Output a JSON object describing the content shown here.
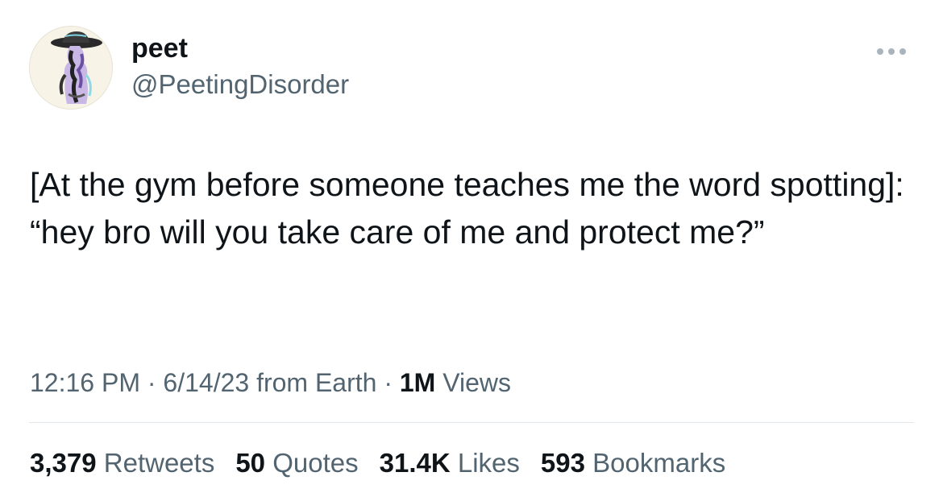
{
  "author": {
    "display_name": "peet",
    "handle": "@PeetingDisorder"
  },
  "tweet": {
    "text": "[At the gym before someone teaches me the word spotting]: “hey bro will you take care of me and protect me?”"
  },
  "meta": {
    "time": "12:16 PM",
    "sep1": " · ",
    "date": "6/14/23",
    "source": " from Earth",
    "sep2": " · ",
    "views_count": "1M",
    "views_label": " Views"
  },
  "stats": [
    {
      "count": "3,379",
      "label": "Retweets"
    },
    {
      "count": "50",
      "label": "Quotes"
    },
    {
      "count": "31.4K",
      "label": "Likes"
    },
    {
      "count": "593",
      "label": "Bookmarks"
    }
  ],
  "icons": {
    "more": "more-horizontal-icon"
  },
  "colors": {
    "text_primary": "#0f1419",
    "text_secondary": "#536471",
    "divider": "#e1e6ea"
  }
}
